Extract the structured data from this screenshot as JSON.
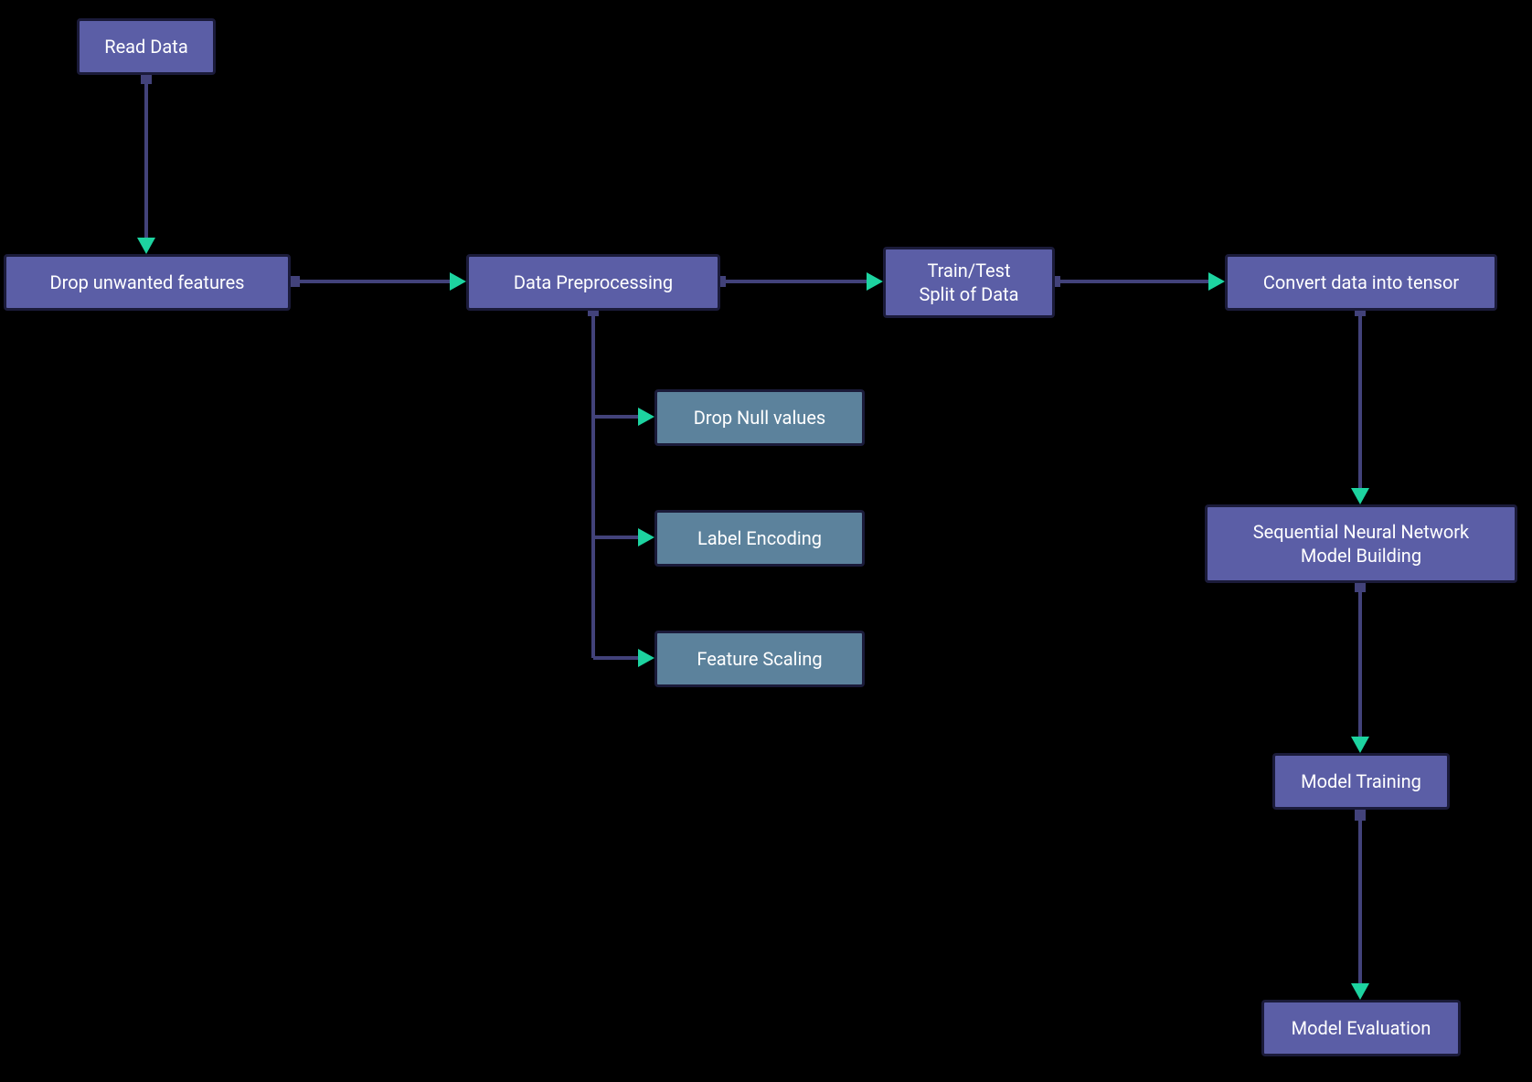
{
  "nodes": {
    "read_data": "Read Data",
    "drop_features": "Drop unwanted features",
    "preprocessing": "Data Preprocessing",
    "drop_null": "Drop Null values",
    "label_encoding": "Label Encoding",
    "feature_scaling": "Feature Scaling",
    "train_test_split": "Train/Test\nSplit of Data",
    "convert_tensor": "Convert data into tensor",
    "model_building": "Sequential Neural Network\nModel Building",
    "model_training": "Model Training",
    "model_evaluation": "Model Evaluation"
  },
  "colors": {
    "main_node": "#5b5ea6",
    "sub_node": "#5c829c",
    "border": "#1b1b3a",
    "connector": "#42427a",
    "arrow": "#1dd3a0",
    "background": "#000000"
  },
  "flow": [
    [
      "read_data",
      "drop_features"
    ],
    [
      "drop_features",
      "preprocessing"
    ],
    [
      "preprocessing",
      "drop_null"
    ],
    [
      "preprocessing",
      "label_encoding"
    ],
    [
      "preprocessing",
      "feature_scaling"
    ],
    [
      "preprocessing",
      "train_test_split"
    ],
    [
      "train_test_split",
      "convert_tensor"
    ],
    [
      "convert_tensor",
      "model_building"
    ],
    [
      "model_building",
      "model_training"
    ],
    [
      "model_training",
      "model_evaluation"
    ]
  ]
}
